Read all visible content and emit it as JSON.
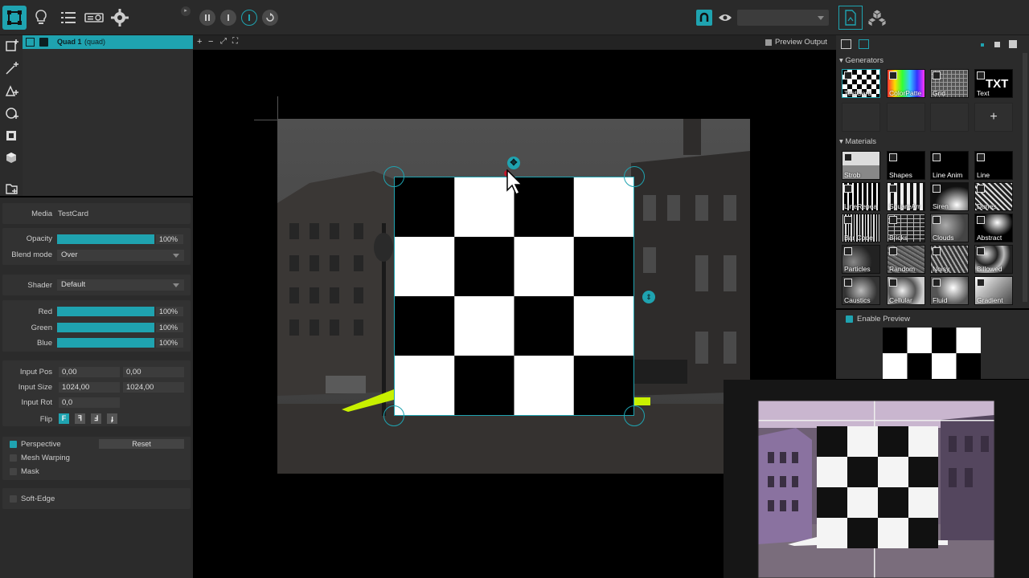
{
  "toolbar": {
    "icons": [
      "mapping-icon",
      "bulb-icon",
      "list-icon",
      "projector-icon",
      "gear-icon",
      "pause-icon",
      "stop-icon",
      "play-icon",
      "rewind-icon",
      "magnet-icon",
      "eye-icon",
      "file-icon",
      "cubes-icon"
    ],
    "output_select": ""
  },
  "layers": {
    "row_label": "Quad 1",
    "row_type": "(quad)"
  },
  "canvas": {
    "tools": [
      "+",
      "−",
      "⤢",
      "⛶"
    ],
    "preview_output": "Preview Output"
  },
  "props": {
    "media_label": "Media",
    "media_value": "TestCard",
    "opacity_label": "Opacity",
    "opacity_value": "100%",
    "opacity_fill": 1.0,
    "blend_label": "Blend mode",
    "blend_value": "Over",
    "shader_label": "Shader",
    "shader_value": "Default",
    "red_label": "Red",
    "red_value": "100%",
    "green_label": "Green",
    "green_value": "100%",
    "blue_label": "Blue",
    "blue_value": "100%",
    "input_pos_label": "Input Pos",
    "input_pos_x": "0,00",
    "input_pos_y": "0,00",
    "input_size_label": "Input Size",
    "input_size_w": "1024,00",
    "input_size_h": "1024,00",
    "input_rot_label": "Input Rot",
    "input_rot_value": "0,0",
    "flip_label": "Flip",
    "flip_glyphs": [
      "F",
      "ꟻ",
      "Ⅎ",
      "ɟ"
    ],
    "perspective_label": "Perspective",
    "reset_label": "Reset",
    "mesh_label": "Mesh Warping",
    "mask_label": "Mask",
    "softedge_label": "Soft-Edge"
  },
  "right": {
    "generators_title": "Generators",
    "generators": [
      "TestCard",
      "ColorPatte",
      "Grid",
      "Text"
    ],
    "text_thumb": "TXT",
    "add_label": "+",
    "materials_title": "Materials",
    "materials": [
      "Strob",
      "Shapes",
      "Line Anim",
      "Line",
      "LineRepea",
      "SquareArr",
      "Siren",
      "Dunes",
      "Bar Code",
      "Bricks",
      "Clouds",
      "Abstract",
      "Particles",
      "Random",
      "Noisy",
      "Billowed",
      "Caustics",
      "Cellular",
      "Fluid",
      "Gradient"
    ],
    "enable_preview": "Enable Preview"
  },
  "colors": {
    "accent": "#1fa3b0",
    "panel": "#2b2b2b",
    "yellow": "#c8f000"
  }
}
